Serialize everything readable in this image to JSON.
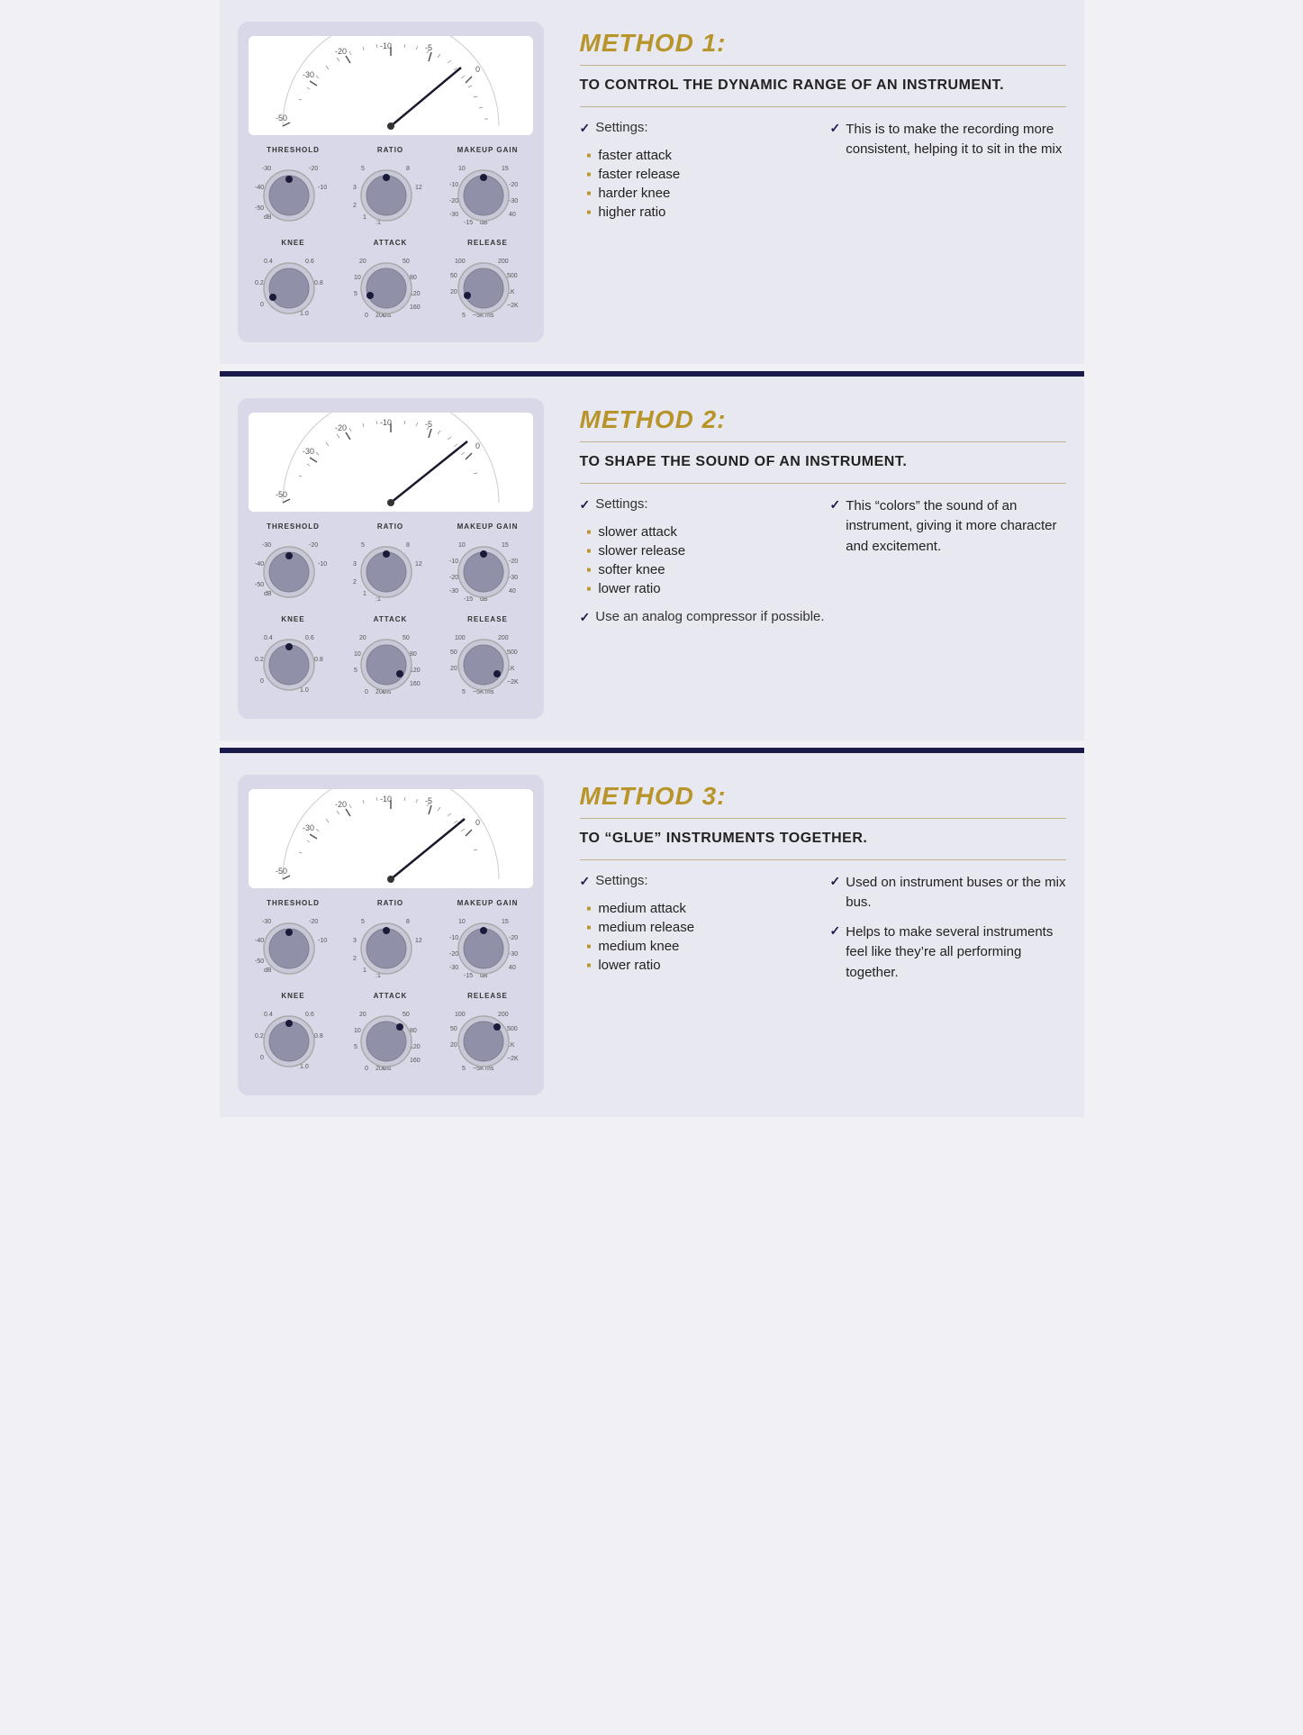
{
  "methods": [
    {
      "id": "method1",
      "title": "METHOD 1:",
      "subtitle": "TO CONTROL THE DYNAMIC RANGE OF AN INSTRUMENT.",
      "settings_label": "Settings:",
      "bullets": [
        "faster attack",
        "faster release",
        "harder knee",
        "higher ratio"
      ],
      "right_text": "This is to make the recording more consistent, helping it to sit in the mix",
      "analog_note": null,
      "knob1_label": "THRESHOLD",
      "knob2_label": "RATIO",
      "knob3_label": "MAKEUP GAIN",
      "knob4_label": "KNEE",
      "knob5_label": "ATTACK",
      "knob6_label": "RELEASE"
    },
    {
      "id": "method2",
      "title": "METHOD 2:",
      "subtitle": "TO SHAPE THE SOUND OF AN INSTRUMENT.",
      "settings_label": "Settings:",
      "bullets": [
        "slower attack",
        "slower release",
        "softer knee",
        "lower ratio"
      ],
      "right_text": "This “colors” the sound of an instrument, giving it more character and excitement.",
      "analog_note": "Use an analog compressor if possible.",
      "knob1_label": "THRESHOLD",
      "knob2_label": "RATIO",
      "knob3_label": "MAKEUP GAIN",
      "knob4_label": "KNEE",
      "knob5_label": "ATTACK",
      "knob6_label": "RELEASE"
    },
    {
      "id": "method3",
      "title": "METHOD 3:",
      "subtitle": "TO “GLUE” INSTRUMENTS TOGETHER.",
      "settings_label": "Settings:",
      "bullets": [
        "medium attack",
        "medium release",
        "medium knee",
        "lower ratio"
      ],
      "right_text_parts": [
        "Used on instrument buses or the mix bus.",
        "Helps to make several instruments feel like they’re all performing together."
      ],
      "analog_note": null,
      "knob1_label": "THRESHOLD",
      "knob2_label": "RATIO",
      "knob3_label": "MAKEUP GAIN",
      "knob4_label": "KNEE",
      "knob5_label": "ATTACK",
      "knob6_label": "RELEASE"
    }
  ],
  "check_symbol": "✓",
  "colors": {
    "gold": "#b8952a",
    "navy": "#1a1a4a",
    "panel_bg": "#d0d0e0",
    "section_bg": "#e8e8f0"
  }
}
